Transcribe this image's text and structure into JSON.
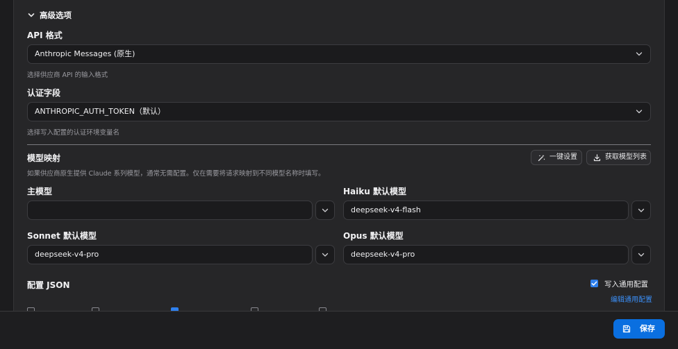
{
  "advanced": {
    "title": "高级选项"
  },
  "api_format": {
    "label": "API 格式",
    "value": "Anthropic Messages (原生)",
    "hint": "选择供应商 API 的输入格式"
  },
  "auth_field": {
    "label": "认证字段",
    "value": "ANTHROPIC_AUTH_TOKEN（默认）",
    "hint": "选择写入配置的认证环境变量名"
  },
  "model_mapping": {
    "title": "模型映射",
    "hint": "如果供应商原生提供 Claude 系列模型，通常无需配置。仅在需要将请求映射到不同模型名称时填写。",
    "one_click_label": "一键设置",
    "fetch_models_label": "获取模型列表",
    "main_model": {
      "label": "主模型",
      "value": ""
    },
    "haiku_model": {
      "label": "Haiku 默认模型",
      "value": "deepseek-v4-flash"
    },
    "sonnet_model": {
      "label": "Sonnet 默认模型",
      "value": "deepseek-v4-pro"
    },
    "opus_model": {
      "label": "Opus 默认模型",
      "value": "deepseek-v4-pro"
    }
  },
  "config_json": {
    "title": "配置 JSON",
    "write_common_label": "写入通用配置",
    "write_common_checked": true,
    "edit_common_link": "编辑通用配置"
  },
  "footer": {
    "save_label": "保存"
  },
  "colors": {
    "accent": "#0a6fe0",
    "link": "#3b8ef5"
  }
}
